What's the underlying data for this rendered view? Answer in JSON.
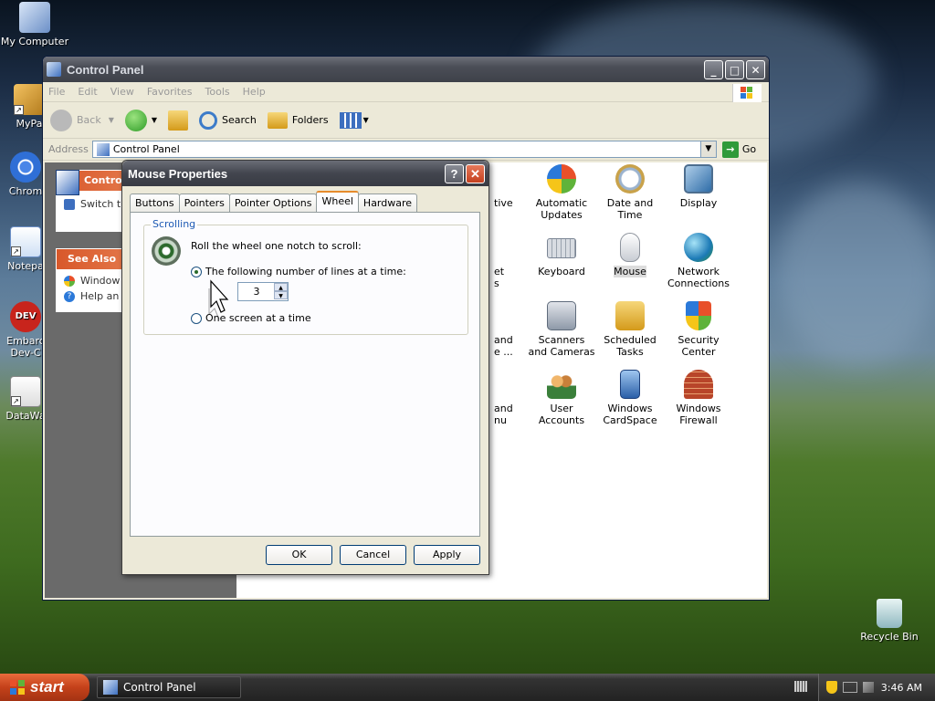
{
  "desktop": {
    "icons": [
      {
        "label": "My Computer"
      },
      {
        "label": "MyPa"
      },
      {
        "label": "Chrom"
      },
      {
        "label": "Notepa"
      },
      {
        "label": "Embarc",
        "label2": "Dev-C"
      },
      {
        "label": "DataWa"
      }
    ],
    "recycle_bin": "Recycle Bin",
    "colors": {
      "sky": "#3b5675",
      "grass": "#4f7a2c"
    }
  },
  "control_panel": {
    "title": "Control Panel",
    "menu": [
      "File",
      "Edit",
      "View",
      "Favorites",
      "Tools",
      "Help"
    ],
    "toolbar": {
      "back": "Back",
      "search": "Search",
      "folders": "Folders"
    },
    "address_label": "Address",
    "address_value": "Control Panel",
    "go_label": "Go",
    "task_panel": {
      "title": "Contro",
      "switch_text": "Switch t",
      "see_also": "See Also",
      "links": [
        "Window",
        "Help an"
      ]
    },
    "items": [
      {
        "label": "tive",
        "icon": "partial-icon"
      },
      {
        "label": "Automatic Updates",
        "icon": "automatic-updates-icon"
      },
      {
        "label": "Date and Time",
        "icon": "date-time-icon"
      },
      {
        "label": "Display",
        "icon": "display-icon"
      },
      {
        "label": "et",
        "label2": "s",
        "icon": "partial-icon"
      },
      {
        "label": "Keyboard",
        "icon": "keyboard-icon"
      },
      {
        "label": "Mouse",
        "icon": "mouse-icon"
      },
      {
        "label": "Network Connections",
        "icon": "network-icon"
      },
      {
        "label": "and",
        "label2": "e ...",
        "icon": "partial-icon"
      },
      {
        "label": "Scanners and Cameras",
        "icon": "scanner-icon"
      },
      {
        "label": "Scheduled Tasks",
        "icon": "scheduled-tasks-icon"
      },
      {
        "label": "Security Center",
        "icon": "security-center-icon"
      },
      {
        "label": "and",
        "label2": "nu",
        "icon": "partial-icon"
      },
      {
        "label": "User Accounts",
        "icon": "user-accounts-icon"
      },
      {
        "label": "Windows CardSpace",
        "icon": "cardspace-icon"
      },
      {
        "label": "Windows Firewall",
        "icon": "firewall-icon"
      }
    ]
  },
  "dialog": {
    "title": "Mouse Properties",
    "help_label": "?",
    "close_label": "✕",
    "tabs": [
      "Buttons",
      "Pointers",
      "Pointer Options",
      "Wheel",
      "Hardware"
    ],
    "active_tab": "Wheel",
    "group_label": "Scrolling",
    "instruction": "Roll the wheel one notch to scroll:",
    "option_lines": "The following number of lines at a time:",
    "option_screen": "One screen at a time",
    "lines_value": "3",
    "buttons": {
      "ok": "OK",
      "cancel": "Cancel",
      "apply": "Apply"
    }
  },
  "taskbar": {
    "start": "start",
    "task_window": "Control Panel",
    "clock": "3:46 AM"
  }
}
